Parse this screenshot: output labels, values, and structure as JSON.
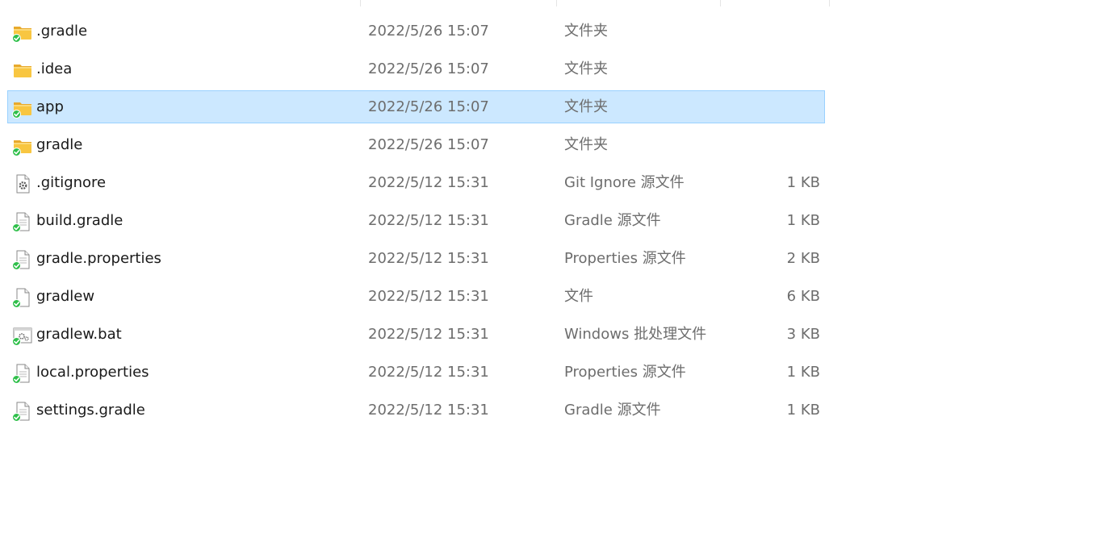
{
  "colors": {
    "selected_bg": "#cce8ff",
    "selected_border": "#99d1ff",
    "folder": "#f8c641",
    "sync_badge": "#2fbf4a",
    "secondary_text": "#6d6d6d"
  },
  "files": [
    {
      "name": ".gradle",
      "date": "2022/5/26 15:07",
      "type": "文件夹",
      "size": "",
      "icon": "folder-icon",
      "synced": true,
      "selected": false
    },
    {
      "name": ".idea",
      "date": "2022/5/26 15:07",
      "type": "文件夹",
      "size": "",
      "icon": "folder-icon",
      "synced": false,
      "selected": false
    },
    {
      "name": "app",
      "date": "2022/5/26 15:07",
      "type": "文件夹",
      "size": "",
      "icon": "folder-icon",
      "synced": true,
      "selected": true
    },
    {
      "name": "gradle",
      "date": "2022/5/26 15:07",
      "type": "文件夹",
      "size": "",
      "icon": "folder-icon",
      "synced": true,
      "selected": false
    },
    {
      "name": ".gitignore",
      "date": "2022/5/12 15:31",
      "type": "Git Ignore 源文件",
      "size": "1 KB",
      "icon": "settings-file-icon",
      "synced": false,
      "selected": false
    },
    {
      "name": "build.gradle",
      "date": "2022/5/12 15:31",
      "type": "Gradle 源文件",
      "size": "1 KB",
      "icon": "text-file-icon",
      "synced": true,
      "selected": false
    },
    {
      "name": "gradle.properties",
      "date": "2022/5/12 15:31",
      "type": "Properties 源文件",
      "size": "2 KB",
      "icon": "text-file-icon",
      "synced": true,
      "selected": false
    },
    {
      "name": "gradlew",
      "date": "2022/5/12 15:31",
      "type": "文件",
      "size": "6 KB",
      "icon": "blank-file-icon",
      "synced": true,
      "selected": false
    },
    {
      "name": "gradlew.bat",
      "date": "2022/5/12 15:31",
      "type": "Windows 批处理文件",
      "size": "3 KB",
      "icon": "batch-file-icon",
      "synced": true,
      "selected": false
    },
    {
      "name": "local.properties",
      "date": "2022/5/12 15:31",
      "type": "Properties 源文件",
      "size": "1 KB",
      "icon": "text-file-icon",
      "synced": true,
      "selected": false
    },
    {
      "name": "settings.gradle",
      "date": "2022/5/12 15:31",
      "type": "Gradle 源文件",
      "size": "1 KB",
      "icon": "text-file-icon",
      "synced": true,
      "selected": false
    }
  ]
}
